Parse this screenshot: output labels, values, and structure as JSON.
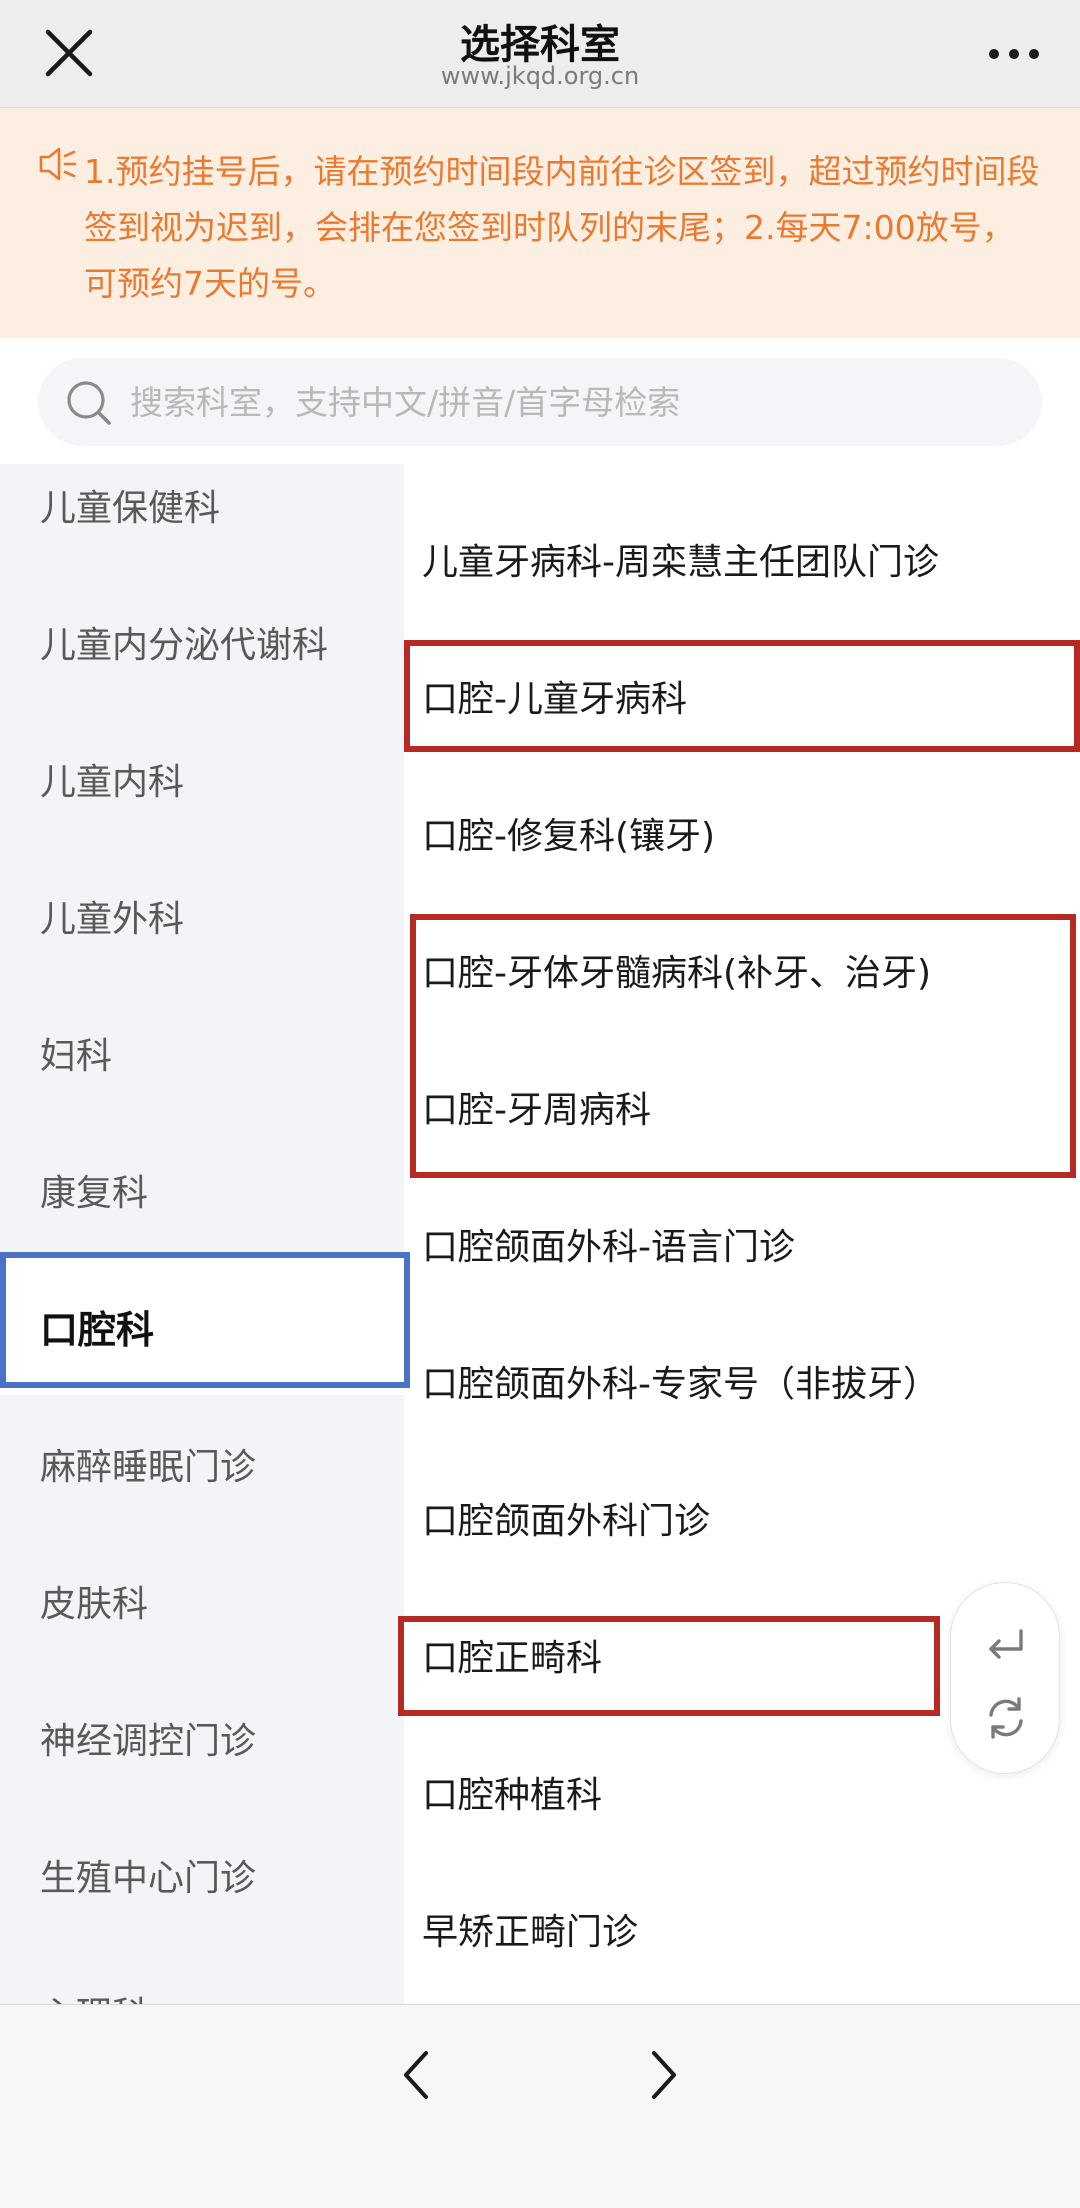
{
  "header": {
    "title": "选择科室",
    "subtitle": "www.jkqd.org.cn",
    "close_icon": "close-icon",
    "more_icon": "more-icon"
  },
  "notice": {
    "icon": "speaker-icon",
    "text": "1.预约挂号后，请在预约时间段内前往诊区签到，超过预约时间段签到视为迟到，会排在您签到时队列的末尾；2.每天7:00放号，可预约7天的号。",
    "color": "#ea7a30",
    "background": "#fdeee2"
  },
  "search": {
    "icon": "search-icon",
    "placeholder": "搜索科室，支持中文/拼音/首字母检索",
    "value": ""
  },
  "sidebar": {
    "items": [
      {
        "label": "儿童保健科"
      },
      {
        "label": "儿童内分泌代谢科"
      },
      {
        "label": "儿童内科"
      },
      {
        "label": "儿童外科"
      },
      {
        "label": "妇科"
      },
      {
        "label": "康复科"
      },
      {
        "label": "口腔科",
        "active": true
      },
      {
        "label": "麻醉睡眠门诊"
      },
      {
        "label": "皮肤科"
      },
      {
        "label": "神经调控门诊"
      },
      {
        "label": "生殖中心门诊"
      },
      {
        "label": "心理科"
      }
    ]
  },
  "departments": [
    {
      "label": "儿童牙病科-周栾慧主任团队门诊"
    },
    {
      "label": "口腔-儿童牙病科"
    },
    {
      "label": "口腔-修复科(镶牙)"
    },
    {
      "label": "口腔-牙体牙髓病科(补牙、治牙)"
    },
    {
      "label": "口腔-牙周病科"
    },
    {
      "label": "口腔颌面外科-语言门诊"
    },
    {
      "label": "口腔颌面外科-专家号（非拔牙）"
    },
    {
      "label": "口腔颌面外科门诊"
    },
    {
      "label": "口腔正畸科"
    },
    {
      "label": "口腔种植科"
    },
    {
      "label": "早矫正畸门诊"
    }
  ],
  "floating_controls": {
    "return_icon": "return-icon",
    "refresh_icon": "refresh-icon"
  },
  "bottom_nav": {
    "back_icon": "chevron-left-icon",
    "forward_icon": "chevron-right-icon"
  },
  "annotation_colors": {
    "red": "#b52a23",
    "blue": "#4a72c7"
  }
}
